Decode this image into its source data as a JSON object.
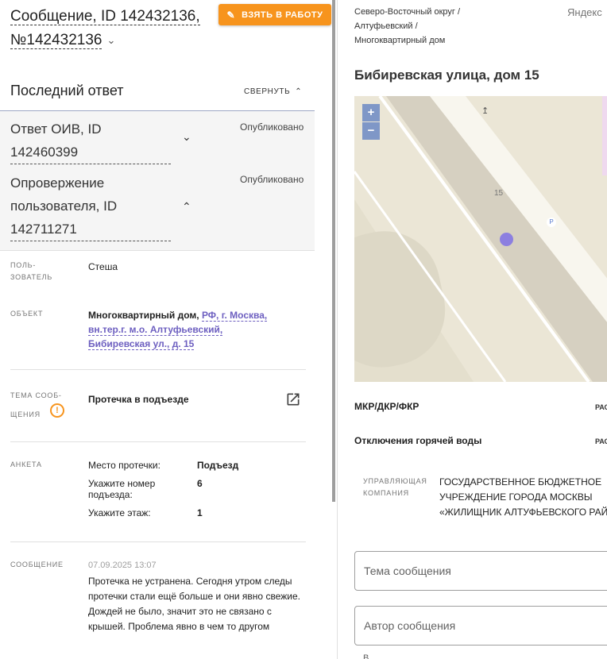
{
  "header": {
    "title_line1": "Сообщение, ID 142432136,",
    "title_line2": "№142432136",
    "take_button": "ВЗЯТЬ В РАБОТУ"
  },
  "last_answer": {
    "heading": "Последний ответ",
    "collapse_label": "СВЕРНУТЬ",
    "items": [
      {
        "title_line1": "Ответ ОИВ, ID",
        "title_line2": "142460399",
        "status": "Опубликовано"
      },
      {
        "title_line1": "Опровержение",
        "title_line2": "пользователя, ID",
        "title_line3": "142711271",
        "status": "Опубликовано"
      }
    ]
  },
  "details": {
    "user_label_1": "ПОЛЬ-",
    "user_label_2": "ЗОВАТЕЛЬ",
    "user_value": "Стеша",
    "object_label": "ОБЪЕКТ",
    "object_type": "Многоквартирный дом,",
    "object_link_1": "РФ, г. Москва,",
    "object_link_2": "вн.тер.г. м.о. Алтуфьевский,",
    "object_link_3": "Бибиревская ул., д. 15",
    "topic_label_1": "ТЕМА СООБ-",
    "topic_label_2": "ЩЕНИЯ",
    "topic_value": "Протечка в подъезде",
    "survey_label": "АНКЕТА",
    "survey": [
      {
        "q1": "Место протечки:",
        "q2": "",
        "a": "Подъезд"
      },
      {
        "q1": "Укажите номер",
        "q2": "подъезда:",
        "a": "6"
      },
      {
        "q1": "Укажите этаж:",
        "q2": "",
        "a": "1"
      }
    ],
    "message_label": "СООБЩЕНИЕ",
    "message_date": "07.09.2025 13:07",
    "message_text": "Протечка не устранена. Сегодня утром следы протечки стали ещё больше и они явно свежие. Дождей не было, значит это не связано с крышей. Проблема явно в чем то другом"
  },
  "right": {
    "crumb_1": "Северо-Восточный округ /",
    "crumb_2": "Алтуфьевский /",
    "crumb_3": "Многоквартирный дом",
    "yandex": "Яндекс",
    "address": "Бибиревская улица, дом 15",
    "map_zoom_in": "+",
    "map_zoom_out": "−",
    "map_house_number": "15",
    "map_parking": "P",
    "mkr_label": "МКР/ДКР/ФКР",
    "mkr_tag": "РАС",
    "hot_water_label": "Отключения горячей воды",
    "hot_water_tag": "РАС",
    "uk_label_1": "УПРАВЛЯЮЩАЯ",
    "uk_label_2": "КОМПАНИЯ",
    "uk_line1": "ГОСУДАРСТВЕННОЕ БЮДЖЕТНОЕ",
    "uk_line2": "УЧРЕЖДЕНИЕ ГОРОДА МОСКВЫ",
    "uk_line3": "«ЖИЛИЩНИК АЛТУФЬЕВСКОГО РАЙ",
    "topic_placeholder": "Тема сообщения",
    "author_placeholder": "Автор сообщения",
    "bottom_partial": "В"
  },
  "colors": {
    "accent": "#f7941d",
    "link": "#6d5fc0",
    "map_marker": "#8c7fe0"
  }
}
